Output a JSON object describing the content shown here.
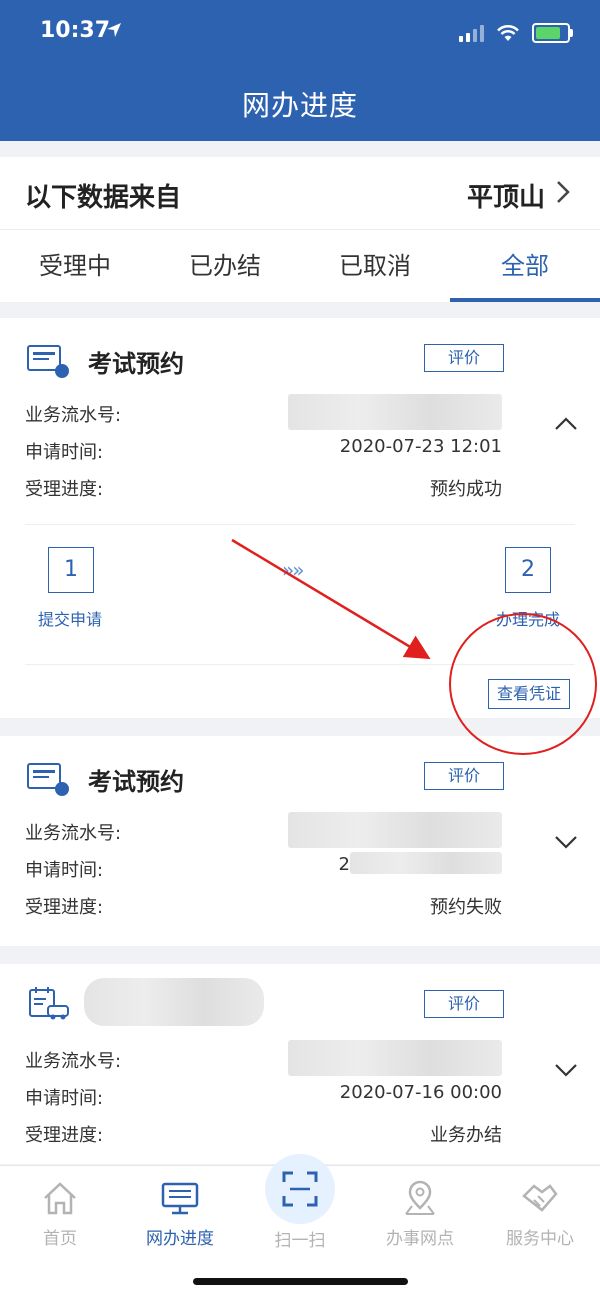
{
  "status_bar": {
    "time": "10:37"
  },
  "header": {
    "title": "网办进度"
  },
  "source": {
    "label": "以下数据来自",
    "city": "平顶山"
  },
  "tabs": [
    {
      "label": "受理中"
    },
    {
      "label": "已办结"
    },
    {
      "label": "已取消"
    },
    {
      "label": "全部",
      "active": true
    }
  ],
  "field_labels": {
    "serial": "业务流水号:",
    "apply_time": "申请时间:",
    "progress": "受理进度:"
  },
  "rate_label": "评价",
  "cards": [
    {
      "title": "考试预约",
      "apply_time": "2020-07-23 12:01",
      "progress": "预约成功",
      "expanded": true,
      "steps": [
        {
          "number": "1",
          "label": "提交申请"
        },
        {
          "number": "2",
          "label": "办理完成"
        }
      ],
      "voucher_label": "查看凭证"
    },
    {
      "title": "考试预约",
      "apply_time": "2",
      "progress": "预约失败",
      "expanded": false
    },
    {
      "title": "",
      "apply_time": "2020-07-16 00:00",
      "progress": "业务办结",
      "expanded": false
    }
  ],
  "bottom_nav": [
    {
      "label": "首页",
      "icon": "home-icon"
    },
    {
      "label": "网办进度",
      "icon": "monitor-icon",
      "active": true
    },
    {
      "label": "扫一扫",
      "icon": "scan-icon"
    },
    {
      "label": "办事网点",
      "icon": "map-pin-icon"
    },
    {
      "label": "服务中心",
      "icon": "handshake-icon"
    }
  ],
  "colors": {
    "brand": "#2c62b0",
    "annotation": "#e0201e",
    "inactive": "#b3b3b3"
  }
}
